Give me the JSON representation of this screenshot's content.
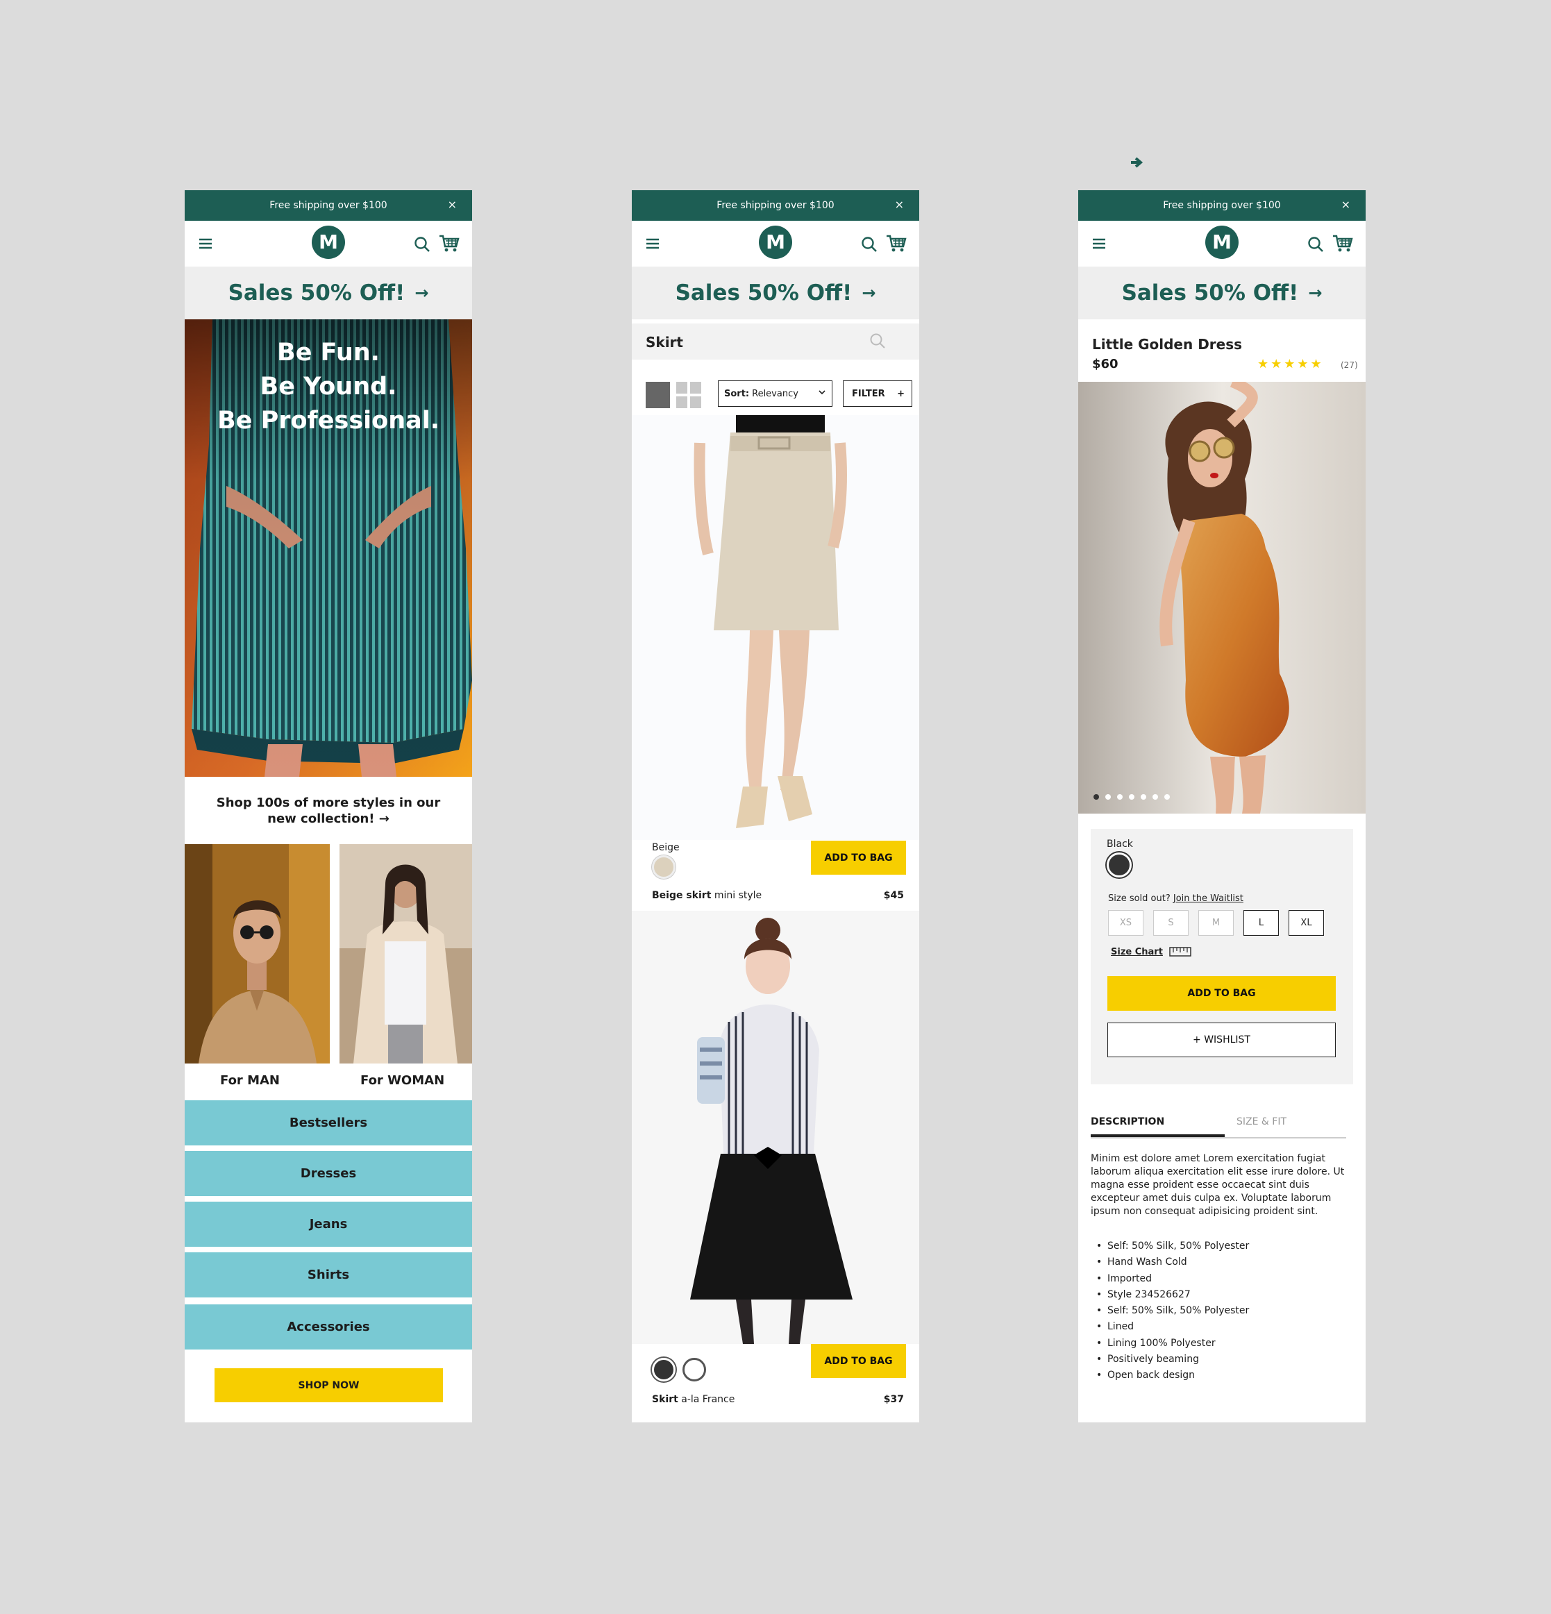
{
  "common": {
    "promo_text": "Free shipping over $100",
    "close_glyph": "×",
    "logo_letter": "M",
    "sales_text": "Sales 50% Off!",
    "sales_arrow": "→",
    "icons": [
      "menu-icon",
      "logo",
      "search-icon",
      "cart-icon",
      "close-icon"
    ],
    "colors": {
      "brand": "#1d5e54",
      "accent": "#f7ce00",
      "category": "#79c9d3",
      "background": "#dcdcdc"
    }
  },
  "home": {
    "hero_lines": [
      "Be Fun.",
      "Be Yound.",
      "Be Professional."
    ],
    "collection_text": "Shop 100s of more styles in our new collection!",
    "collection_arrow": "→",
    "for_man": "For MAN",
    "for_woman": "For WOMAN",
    "categories": [
      "Bestsellers",
      "Dresses",
      "Jeans",
      "Shirts",
      "Accessories"
    ],
    "shop_now": "SHOP NOW"
  },
  "listing": {
    "search_label": "Skirt",
    "sort_label": "Sort:",
    "sort_value": "Relevancy",
    "filter_label": "FILTER",
    "filter_plus": "+",
    "products": [
      {
        "color_label": "Beige",
        "add_label": "ADD TO BAG",
        "name_bold": "Beige skirt",
        "name_rest": "mini style",
        "price": "$45",
        "swatches": [
          "#dcd1bd"
        ]
      },
      {
        "color_label": "",
        "add_label": "ADD TO BAG",
        "name_bold": "Skirt",
        "name_rest": "a-la France",
        "price": "$37",
        "swatches": [
          "#333333",
          "#ffffff"
        ]
      }
    ]
  },
  "detail": {
    "title": "Little Golden Dress",
    "price": "$60",
    "stars": "★★★★★",
    "rating": 5,
    "review_count": "(27)",
    "image_dots": 7,
    "active_dot": 0,
    "color_label": "Black",
    "swatch_color": "#333333",
    "size_sold_out": "Size sold out?",
    "waitlist_link": "Join the Waitlist",
    "sizes": [
      {
        "label": "XS",
        "available": false
      },
      {
        "label": "S",
        "available": false
      },
      {
        "label": "M",
        "available": false
      },
      {
        "label": "L",
        "available": true
      },
      {
        "label": "XL",
        "available": true
      }
    ],
    "size_chart": "Size Chart",
    "add_to_bag": "ADD TO BAG",
    "wishlist": "+ WISHLIST",
    "tab_description": "DESCRIPTION",
    "tab_size_fit": "SIZE & FIT",
    "description": "Minim est dolore amet Lorem exercitation fugiat laborum aliqua exercitation elit esse irure dolore. Ut magna esse proident esse occaecat sint duis excepteur amet duis culpa ex. Voluptate laborum ipsum non consequat adipisicing proident sint.",
    "features": [
      "Self: 50% Silk, 50% Polyester",
      "Hand Wash Cold",
      "Imported",
      "Style 234526627",
      "Self: 50% Silk, 50% Polyester",
      "Lined",
      "Lining 100% Polyester",
      "Positively beaming",
      "Open back design"
    ]
  }
}
